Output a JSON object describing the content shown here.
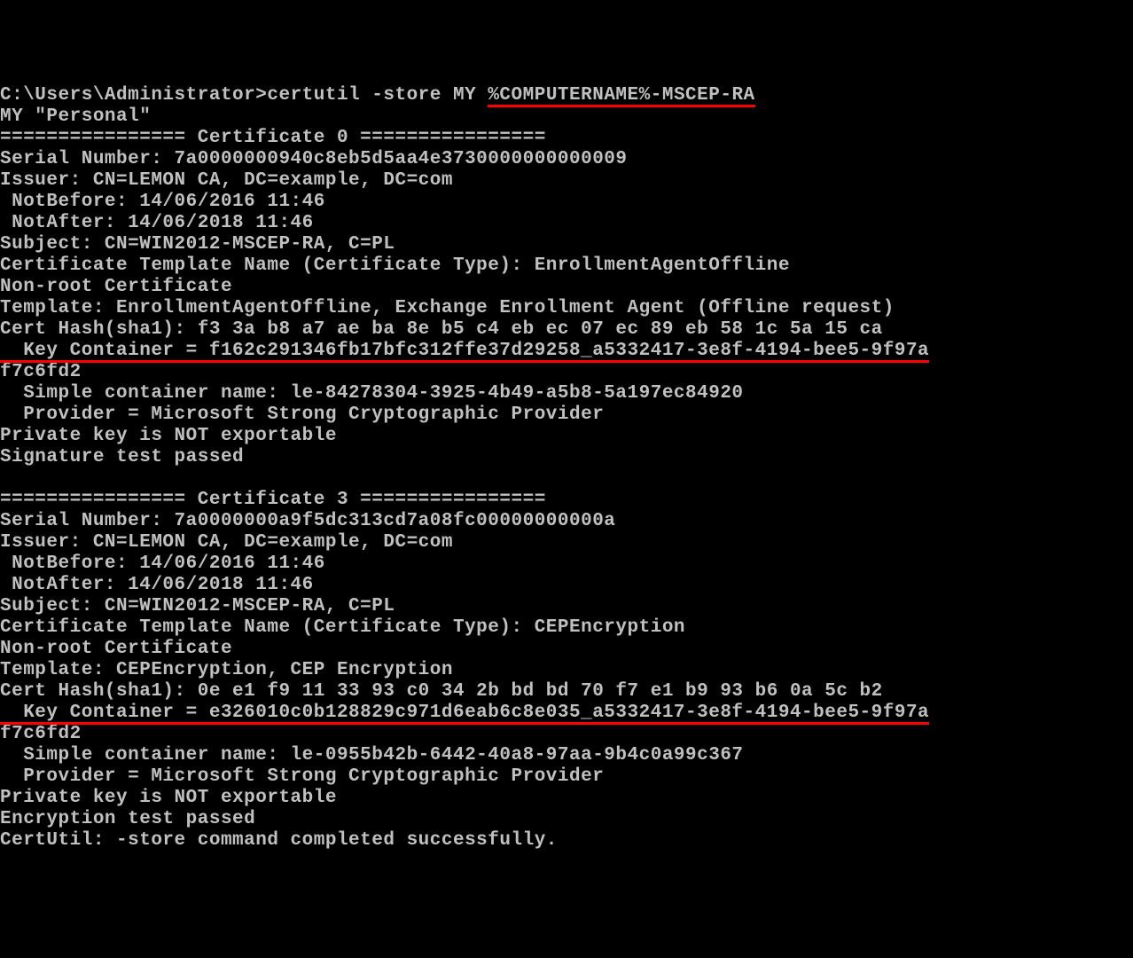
{
  "prompt": "C:\\Users\\Administrator>",
  "command": "certutil -store MY ",
  "command_arg": "%COMPUTERNAME%-MSCEP-RA",
  "store_line": "MY \"Personal\"",
  "cert0": {
    "header": "================ Certificate 0 ================",
    "serial": "Serial Number: 7a0000000940c8eb5d5aa4e3730000000000009",
    "issuer": "Issuer: CN=LEMON CA, DC=example, DC=com",
    "notbefore": " NotBefore: 14/06/2016 11:46",
    "notafter": " NotAfter: 14/06/2018 11:46",
    "subject": "Subject: CN=WIN2012-MSCEP-RA, C=PL",
    "templatename": "Certificate Template Name (Certificate Type): EnrollmentAgentOffline",
    "nonroot": "Non-root Certificate",
    "template": "Template: EnrollmentAgentOffline, Exchange Enrollment Agent (Offline request)",
    "hash": "Cert Hash(sha1): f3 3a b8 a7 ae ba 8e b5 c4 eb ec 07 ec 89 eb 58 1c 5a 15 ca",
    "keycontainer": "  Key Container = f162c291346fb17bfc312ffe37d29258_a5332417-3e8f-4194-bee5-9f97a",
    "keycontainer2": "f7c6fd2",
    "simple": "  Simple container name: le-84278304-3925-4b49-a5b8-5a197ec84920",
    "provider": "  Provider = Microsoft Strong Cryptographic Provider",
    "private": "Private key is NOT exportable",
    "test": "Signature test passed"
  },
  "cert3": {
    "header": "================ Certificate 3 ================",
    "serial": "Serial Number: 7a0000000a9f5dc313cd7a08fc00000000000a",
    "issuer": "Issuer: CN=LEMON CA, DC=example, DC=com",
    "notbefore": " NotBefore: 14/06/2016 11:46",
    "notafter": " NotAfter: 14/06/2018 11:46",
    "subject": "Subject: CN=WIN2012-MSCEP-RA, C=PL",
    "templatename": "Certificate Template Name (Certificate Type): CEPEncryption",
    "nonroot": "Non-root Certificate",
    "template": "Template: CEPEncryption, CEP Encryption",
    "hash": "Cert Hash(sha1): 0e e1 f9 11 33 93 c0 34 2b bd bd 70 f7 e1 b9 93 b6 0a 5c b2",
    "keycontainer": "  Key Container = e326010c0b128829c971d6eab6c8e035_a5332417-3e8f-4194-bee5-9f97a",
    "keycontainer2": "f7c6fd2",
    "simple": "  Simple container name: le-0955b42b-6442-40a8-97aa-9b4c0a99c367",
    "provider": "  Provider = Microsoft Strong Cryptographic Provider",
    "private": "Private key is NOT exportable",
    "test": "Encryption test passed"
  },
  "final": "CertUtil: -store command completed successfully."
}
